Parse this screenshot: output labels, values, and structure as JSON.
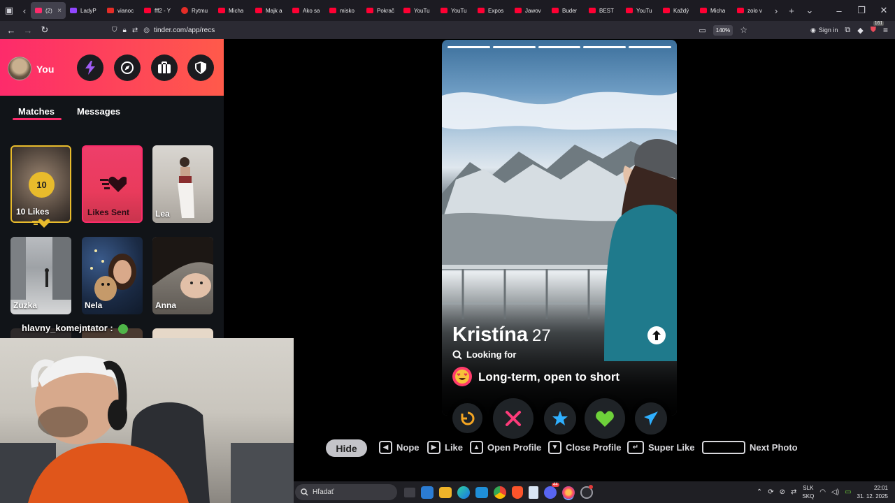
{
  "browser": {
    "active_tab": {
      "title": "(2)",
      "close": "×"
    },
    "tabs": [
      {
        "title": "LadyP",
        "color": "#9146ff",
        "shape": "square"
      },
      {
        "title": "vianoc",
        "color": "#e52d27",
        "shape": "square"
      },
      {
        "title": "fff2 - Y",
        "color": "#ff0033",
        "shape": "square"
      },
      {
        "title": "Rytmu",
        "color": "#e52d27",
        "shape": "round"
      },
      {
        "title": "Micha",
        "color": "#ff0033",
        "shape": "square"
      },
      {
        "title": "Majk a",
        "color": "#ff0033",
        "shape": "square"
      },
      {
        "title": "Ako sa",
        "color": "#ff0033",
        "shape": "square"
      },
      {
        "title": "misko",
        "color": "#ff0033",
        "shape": "square"
      },
      {
        "title": "Pokrač",
        "color": "#ff0033",
        "shape": "square"
      },
      {
        "title": "YouTu",
        "color": "#ff0033",
        "shape": "square"
      },
      {
        "title": "YouTu",
        "color": "#ff0033",
        "shape": "square"
      },
      {
        "title": "Expos",
        "color": "#ff0033",
        "shape": "square"
      },
      {
        "title": "Jawov",
        "color": "#ff0033",
        "shape": "square"
      },
      {
        "title": "Buder",
        "color": "#ff0033",
        "shape": "square"
      },
      {
        "title": "BEST",
        "color": "#ff0033",
        "shape": "square"
      },
      {
        "title": "YouTu",
        "color": "#ff0033",
        "shape": "square"
      },
      {
        "title": "Každý",
        "color": "#ff0033",
        "shape": "square"
      },
      {
        "title": "Micha",
        "color": "#ff0033",
        "shape": "square"
      },
      {
        "title": "zolo v",
        "color": "#ff0033",
        "shape": "square"
      }
    ],
    "url": "tinder.com/app/recs",
    "zoom": "140%",
    "sign_in": "Sign in",
    "extension_badge": "161"
  },
  "sidebar": {
    "you_label": "You",
    "tabs": {
      "matches": "Matches",
      "messages": "Messages"
    },
    "likes_card": {
      "count": "10",
      "label": "10 Likes"
    },
    "likes_sent_card": {
      "label": "Likes Sent"
    },
    "matches": [
      {
        "name": "Lea"
      },
      {
        "name": "Zuzka"
      },
      {
        "name": "Nela"
      },
      {
        "name": "Anna"
      }
    ],
    "chat_overlay": "hlavny_komejntator :"
  },
  "profile": {
    "name": "Kristína",
    "age": "27",
    "looking_for_label": "Looking for",
    "goal": "Long-term, open to short",
    "photo_count": 5,
    "current_photo": 1
  },
  "shortcuts": {
    "hide": "Hide",
    "nope": "Nope",
    "like": "Like",
    "open_profile": "Open Profile",
    "close_profile": "Close Profile",
    "super_like": "Super Like",
    "next_photo": "Next Photo"
  },
  "taskbar": {
    "search_placeholder": "Hľadať",
    "discord_badge": "44",
    "lang_top": "SLK",
    "lang_bottom": "SKQ",
    "time": "22:01",
    "date": "31. 12. 2025"
  },
  "colors": {
    "brand_gradient_start": "#fd2b6b",
    "brand_gradient_end": "#ff5a4a",
    "nope": "#fd3b7a",
    "like": "#6ed13a",
    "super_like": "#2fb0ff",
    "rewind": "#f5a623",
    "boost": "#a05cf5"
  }
}
